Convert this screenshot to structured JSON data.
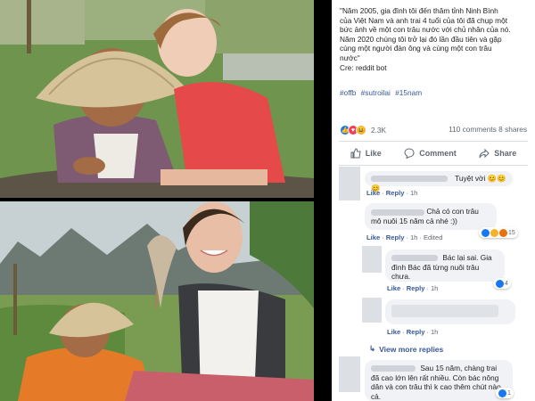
{
  "post": {
    "text_lines": [
      "\"Năm 2005, gia đình tôi đến thăm tỉnh Ninh Bình",
      "của Việt Nam và anh trai 4 tuổi của tôi đã chụp một",
      "bức ảnh về một con trâu nước với chủ nhân của nó.",
      "Năm 2020 chúng tôi trở lại đó lần đầu tiên và gặp",
      "cùng một người đàn ông và cùng một con trâu",
      "nước\"",
      "Cre: reddit bot"
    ],
    "hashtags": [
      "#offb",
      "#sutroilai",
      "#15nam"
    ],
    "reaction_count": "2.3K",
    "comments_shares": "110 comments  8 shares"
  },
  "actions": {
    "like": "Like",
    "comment": "Comment",
    "share": "Share"
  },
  "comments": [
    {
      "text": "Tuyệt vời 😊😊😊",
      "meta_like": "Like",
      "meta_reply": "Reply",
      "meta_time": "1h"
    },
    {
      "text": "Chả có con trâu mô nuôi 15 năm cả nhé :))",
      "meta_like": "Like",
      "meta_reply": "Reply",
      "meta_time": "1h",
      "meta_extra": "Edited",
      "reaction_count": "15"
    },
    {
      "text": "Bác lại sai. Gia đình Bác đã từng nuôi trâu chưa.",
      "meta_like": "Like",
      "meta_reply": "Reply",
      "meta_time": "1h",
      "reaction_count": "4"
    },
    {
      "text": "",
      "meta_like": "Like",
      "meta_reply": "Reply",
      "meta_time": "1h"
    },
    {
      "text": "Sau 15 năm, chàng trai đã cao lớn lên rất nhiều. Còn bác nông dân và con trâu thì k cao thêm chút nào cả.",
      "reaction_count": "1"
    }
  ],
  "view_more": "View more replies",
  "colors": {
    "fb_blue": "#385898",
    "like_blue": "#1877f2",
    "bubble": "#f0f2f5"
  }
}
